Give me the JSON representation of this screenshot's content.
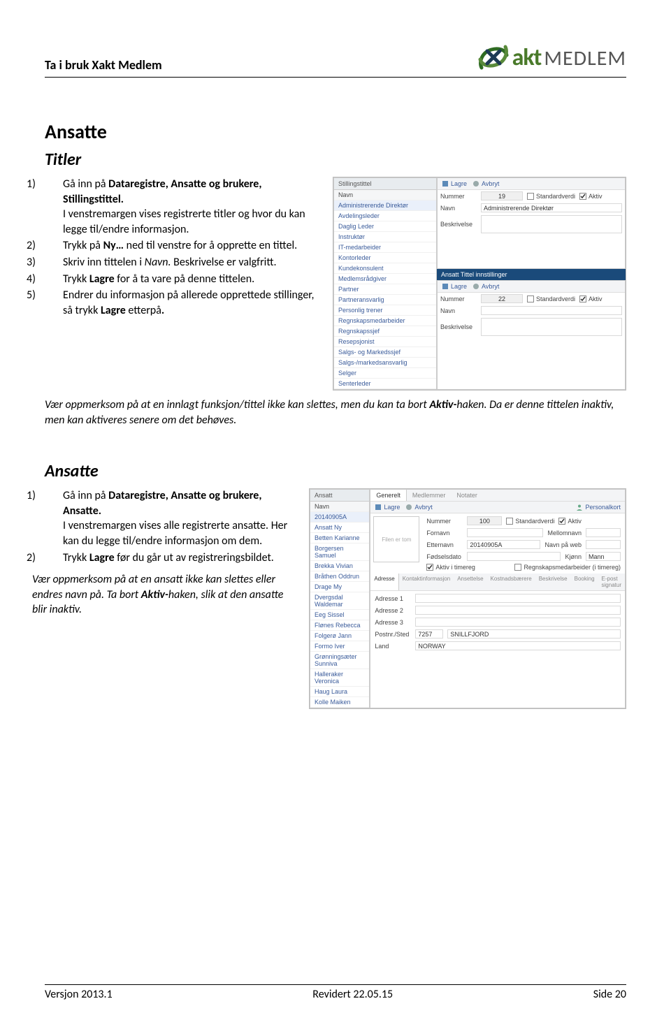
{
  "header": {
    "title": "Ta i bruk Xakt Medlem"
  },
  "logo": {
    "akt": "akt",
    "medlem": "MEDLEM"
  },
  "section1": {
    "h1": "Ansatte",
    "h2": "Titler",
    "steps": [
      {
        "num": "1)",
        "pre": "Gå inn på ",
        "b1": "Dataregistre, Ansatte og brukere, Stillingstittel.",
        "post1": "I venstremargen vises registrerte titler og hvor du kan legge til/endre informasjon."
      },
      {
        "num": "2)",
        "pre": "Trykk på ",
        "b1": "Ny…",
        "post1": " ned til venstre for å opprette en tittel."
      },
      {
        "num": "3)",
        "pre": "Skriv inn tittelen i ",
        "i1": "Navn.",
        "post1": " Beskrivelse er valgfritt."
      },
      {
        "num": "4)",
        "pre": "Trykk ",
        "b1": "Lagre",
        "post1": " for å ta vare på denne tittelen."
      },
      {
        "num": "5)",
        "pre": "Endrer du informasjon på allerede opprettede stillinger, så trykk ",
        "b1": "Lagre",
        "post1": " etterpå",
        "b2": "."
      }
    ],
    "note": {
      "a": "Vær oppmerksom på at en innlagt funksjon/tittel ikke kan slettes, men du kan ta bort ",
      "b": "Aktiv-",
      "c": "haken. Da er denne tittelen inaktiv, men kan aktiveres senere om det behøves."
    }
  },
  "mock1": {
    "leftTitle": "Stillingstittel",
    "navn": "Navn",
    "items": [
      "Administrerende Direktør",
      "Avdelingsleder",
      "Daglig Leder",
      "Instruktør",
      "IT-medarbeider",
      "Kontorleder",
      "Kundekonsulent",
      "Medlemsrådgiver",
      "Partner",
      "Partneransvarlig",
      "Personlig trener",
      "Regnskapsmedarbeider",
      "Regnskapssjef",
      "Resepsjonist",
      "Salgs- og Markedssjef",
      "Salgs-/markedsansvarlig",
      "Selger",
      "Senterleder"
    ],
    "toolbar": {
      "lagre": "Lagre",
      "avbryt": "Avbryt"
    },
    "top": {
      "nummerLbl": "Nummer",
      "nummerVal": "19",
      "standard": "Standardverdi",
      "aktiv": "Aktiv",
      "navnLbl": "Navn",
      "navnVal": "Administrerende Direktør",
      "beskLbl": "Beskrivelse"
    },
    "midBar": "Ansatt Tittel innstillinger",
    "bot": {
      "nummerLbl": "Nummer",
      "nummerVal": "22",
      "standard": "Standardverdi",
      "aktiv": "Aktiv",
      "navnLbl": "Navn",
      "beskLbl": "Beskrivelse"
    }
  },
  "section2": {
    "h2": "Ansatte",
    "steps": [
      {
        "num": "1)",
        "pre": "Gå inn på ",
        "b1": "Dataregistre, Ansatte og brukere, Ansatte.",
        "post1": "I venstremargen vises alle registrerte ansatte. Her kan du legge til/endre informasjon om dem."
      },
      {
        "num": "2)",
        "pre": "Trykk ",
        "b1": "Lagre",
        "post1": " før du går ut av registreringsbildet."
      }
    ],
    "note": {
      "a": "Vær oppmerksom på at en ansatt ikke kan slettes eller endres navn på. Ta bort ",
      "b": "Aktiv-",
      "c": "haken, slik at den ansatte blir inaktiv."
    }
  },
  "mock2": {
    "leftTitle": "Ansatt",
    "navn": "Navn",
    "items": [
      "20140905A",
      "Ansatt Ny",
      "Betten Karianne",
      "Borgersen Samuel",
      "Brekka Vivian",
      "Bråthen Oddrun",
      "Drage My",
      "Dvergsdal Waldemar",
      "Eeg Sissel",
      "Flønes Rebecca",
      "Folgerø Jann",
      "Formo Iver",
      "Grønningsæter Sunniva",
      "Halleraker Veronica",
      "Haug Laura",
      "Kolle Maiken"
    ],
    "tabsTop": [
      "Generelt",
      "Medlemmer",
      "Notater"
    ],
    "toolbar": {
      "lagre": "Lagre",
      "avbryt": "Avbryt",
      "personalkort": "Personalkort"
    },
    "top": {
      "nummerLbl": "Nummer",
      "nummerVal": "100",
      "standard": "Standardverdi",
      "aktiv": "Aktiv",
      "fornavnLbl": "Fornavn",
      "mellomLbl": "Mellomnavn",
      "etternavnLbl": "Etternavn",
      "etternavnVal": "20140905A",
      "navnWebLbl": "Navn på web",
      "fodselLbl": "Fødselsdato",
      "kjonnLbl": "Kjønn",
      "kjonnVal": "Mann",
      "aktivTime": "Aktiv i timereg",
      "regnskap": "Regnskapsmedarbeider (i timereg)"
    },
    "filenTom": "Filen er tom",
    "tabsBot": [
      "Adresse",
      "Kontaktinformasjon",
      "Ansettelse",
      "Kostnadsbærere",
      "Beskrivelse",
      "Booking",
      "E-post signatur"
    ],
    "addr": {
      "a1": "Adresse 1",
      "a2": "Adresse 2",
      "a3": "Adresse 3",
      "postLbl": "Postnr./Sted",
      "postVal": "7257",
      "stedVal": "SNILLFJORD",
      "landLbl": "Land",
      "landVal": "NORWAY"
    }
  },
  "footer": {
    "left": "Versjon 2013.1",
    "mid": "Revidert 22.05.15",
    "right": "Side 20"
  }
}
